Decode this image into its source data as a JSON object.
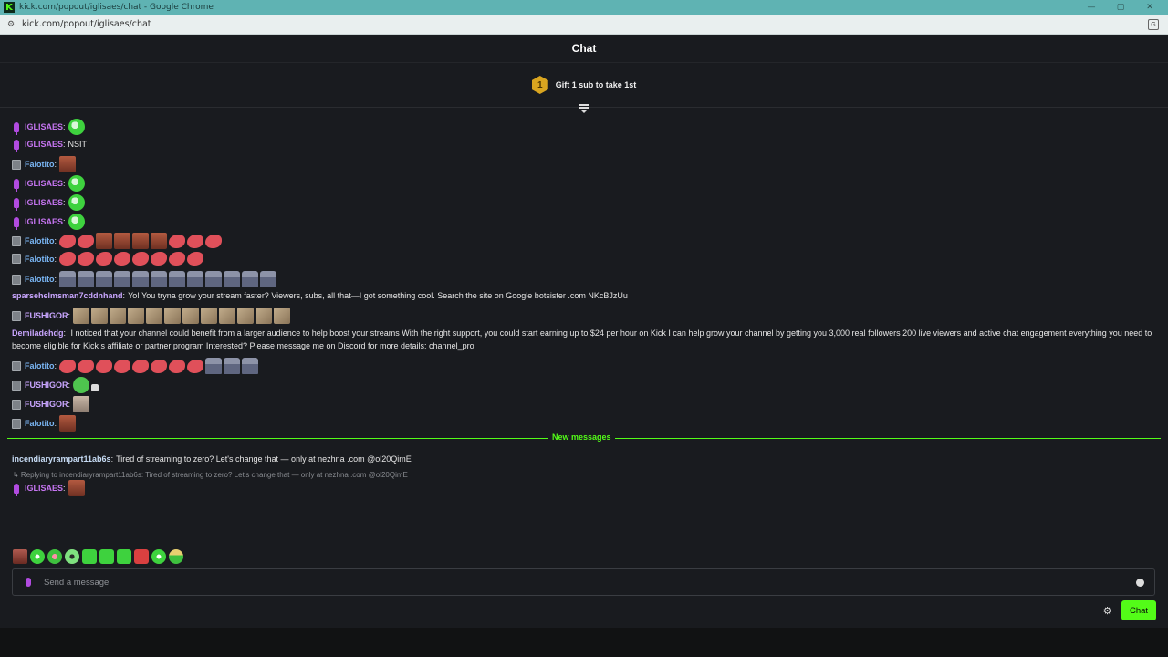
{
  "window": {
    "title": "kick.com/popout/iglisaes/chat - Google Chrome",
    "logo": "K",
    "controls": [
      "—",
      "▢",
      "✕"
    ],
    "url": "kick.com/popout/iglisaes/chat"
  },
  "chat": {
    "header": "Chat",
    "gift": {
      "rank": "1",
      "text": "Gift 1 sub to take 1st"
    },
    "new_messages_label": "New messages",
    "messages": [
      {
        "user": "IGLISAES",
        "text": ""
      },
      {
        "user": "IGLISAES",
        "text": "NSIT"
      },
      {
        "user": "Falotito",
        "text": ""
      },
      {
        "user": "IGLISAES",
        "text": ""
      },
      {
        "user": "IGLISAES",
        "text": ""
      },
      {
        "user": "IGLISAES",
        "text": ""
      },
      {
        "user": "Falotito",
        "text": ""
      },
      {
        "user": "Falotito",
        "text": ""
      },
      {
        "user": "Falotito",
        "text": ""
      },
      {
        "user": "sparsehelmsman7cddnhand",
        "text": "Yo! You tryna grow your stream faster? Viewers, subs, all that—I got something cool. Search the site on Google botsister .com NKcBJzUu"
      },
      {
        "user": "FUSHIGOR",
        "text": ""
      },
      {
        "user": "Demiladehdg",
        "text": "I noticed that your channel could benefit from a larger audience to help boost your streams With the right support, you could start earning up to $24 per hour on Kick I can help grow your channel by getting you 3,000 real followers 200 live viewers and active chat engagement everything you need to become eligible for Kick s affiliate or partner program Interested? Please message me on Discord for more details: channel_pro"
      },
      {
        "user": "Falotito",
        "text": ""
      },
      {
        "user": "FUSHIGOR",
        "text": ""
      },
      {
        "user": "FUSHIGOR",
        "text": ""
      },
      {
        "user": "Falotito",
        "text": ""
      },
      {
        "user": "incendiaryrampart11ab6s",
        "text": "Tired of streaming to zero? Let's change that — only at nezhna .com @ol20QimE"
      },
      {
        "user": "IGLISAES",
        "text": ""
      }
    ],
    "reply_preview": "↳ Replying to incendiaryrampart11ab6s: Tired of streaming to zero? Let's change that — only at nezhna .com @ol20QimE",
    "input_placeholder": "Send a message",
    "send_label": "Chat"
  },
  "colors": {
    "accent": "#53fc18",
    "background": "#191b1f",
    "owner_name": "#c574f0",
    "sub_name": "#7ab6f5"
  },
  "icons": [
    "kick-logo-icon",
    "site-info-icon",
    "translate-icon",
    "gift-medal-icon",
    "collapse-icon",
    "microphone-icon",
    "subscriber-badge-icon",
    "emoji-icon",
    "settings-icon"
  ]
}
